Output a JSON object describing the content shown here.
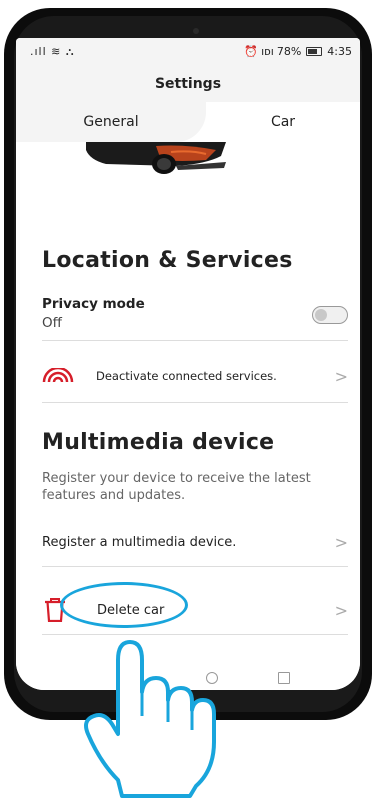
{
  "status_bar": {
    "signal": ".ıll ≋ ⛬",
    "alarm": "⏰",
    "battery_text": "78%",
    "time": "4:35"
  },
  "header": {
    "title": "Settings"
  },
  "tabs": [
    {
      "label": "General"
    },
    {
      "label": "Car"
    }
  ],
  "location": {
    "title": "Location & Services",
    "privacy_label": "Privacy mode",
    "privacy_value": "Off",
    "privacy_toggle_on": false,
    "deactivate_label": "Deactivate connected services."
  },
  "multimedia": {
    "title": "Multimedia device",
    "description": "Register your device to receive the latest features and updates.",
    "register_label": "Register a multimedia device."
  },
  "delete": {
    "label": "Delete car"
  },
  "chevron": ">",
  "colors": {
    "accent_red": "#d61e2a",
    "highlight_blue": "#19a5dc",
    "header_bg": "#f4f4f4"
  }
}
